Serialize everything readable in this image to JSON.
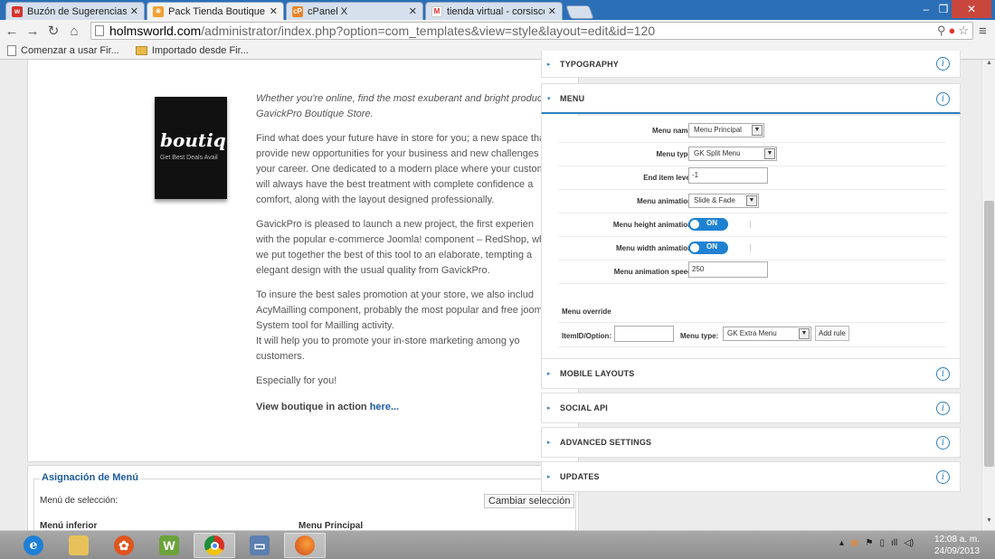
{
  "browser": {
    "tabs": [
      {
        "title": "Buzón de Sugerencias - Fc",
        "favicon": "w-icon",
        "active": false
      },
      {
        "title": "Pack Tienda Boutique - Ac",
        "favicon": "joomla-icon",
        "active": true
      },
      {
        "title": "cPanel X",
        "favicon": "cpanel-icon",
        "active": false
      },
      {
        "title": "tienda virtual - corsiscom",
        "favicon": "gmail-icon",
        "active": false
      }
    ],
    "url_host": "holmsworld.com",
    "url_path": "/administrator/index.php?option=com_templates&view=style&layout=edit&id=120",
    "bookmarks": [
      "Comenzar a usar Fir...",
      "Importado desde Fir..."
    ]
  },
  "article": {
    "image_word": "boutiqu",
    "image_tag": "Get Best Deals Avail",
    "paragraphs": [
      [
        "Whether you're online, find the most exuberant and bright products",
        "GavickPro Boutique Store."
      ],
      [
        "Find what does your future have in store for you; a new space that",
        "provide new opportunities for your business and new challenges",
        "your career. One dedicated to a modern place where your custome",
        "will always have the best treatment with complete confidence a",
        "comfort, along with the layout designed professionally."
      ],
      [
        "GavickPro is pleased to launch a new project, the first experien",
        "with the popular e-commerce Joomla! component – RedShop, whi",
        "we put together the best of this tool to an elaborate, tempting a",
        "elegant design with the usual quality from GavickPro."
      ],
      [
        "To insure the best sales promotion at your store, we also includ",
        "AcyMailling component, probably the most popular and free joom",
        "System tool for Mailling activity.",
        "It will help you to promote your in-store marketing among yo",
        "customers."
      ],
      [
        "Especially for you!"
      ]
    ],
    "view_prefix": "View boutique in action ",
    "view_link": "here..."
  },
  "menu_assignment": {
    "legend": "Asignación de Menú",
    "selection_label": "Menú de selección:",
    "change_button": "Cambiar selección",
    "col1": "Menú inferior",
    "col2": "Menu Principal"
  },
  "panel": {
    "sections_top": [
      "TYPOGRAPHY"
    ],
    "open_section": "MENU",
    "fields": [
      {
        "label": "Menu name",
        "type": "select",
        "value": "Menu Principal"
      },
      {
        "label": "Menu type",
        "type": "select",
        "value": "GK Split Menu"
      },
      {
        "label": "End item level",
        "type": "input",
        "value": "-1"
      },
      {
        "label": "Menu animation",
        "type": "select",
        "value": "Slide & Fade"
      },
      {
        "label": "Menu height animation",
        "type": "toggle",
        "value": "ON"
      },
      {
        "label": "Menu width animation",
        "type": "toggle",
        "value": "ON"
      },
      {
        "label": "Menu animation speed",
        "type": "input",
        "value": "250"
      }
    ],
    "override": {
      "title": "Menu override",
      "itemid_label": "ItemID/Option:",
      "menutype_label": "Menu type:",
      "menutype_value": "GK Extra Menu",
      "add_rule": "Add rule"
    },
    "sections_bottom": [
      "MOBILE LAYOUTS",
      "SOCIAL API",
      "ADVANCED SETTINGS",
      "UPDATES"
    ],
    "info_glyph": "i"
  },
  "taskbar": {
    "clock_time": "12:08 a. m.",
    "clock_date": "24/09/2013"
  }
}
